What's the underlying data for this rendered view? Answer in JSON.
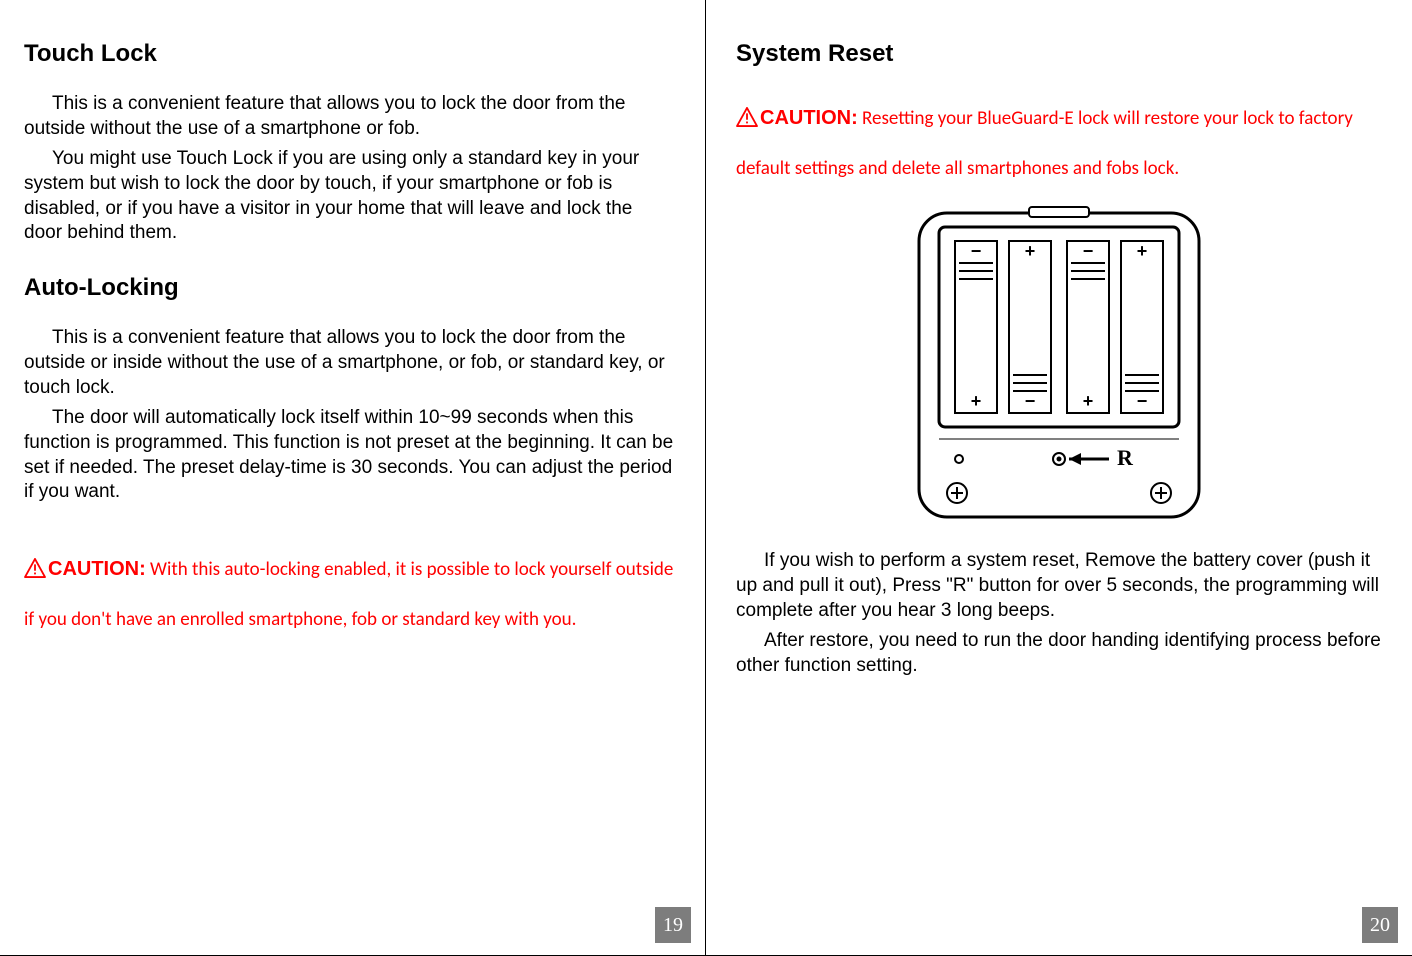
{
  "left": {
    "heading1": "Touch Lock",
    "p1": "This is a convenient feature that allows you to lock the door from the outside without the use of a smartphone or fob.",
    "p2": "You might use Touch Lock if you are using only a standard key in your system but wish to lock the door by touch, if your smartphone or fob is disabled, or if you have a visitor in your home that will leave and lock the door behind them.",
    "heading2": "Auto-Locking",
    "p3": "This is a convenient feature that allows you to lock the door from the outside or inside without the use of a smartphone, or fob, or standard key, or touch lock.",
    "p4": "The door will automatically lock itself within 10~99 seconds when this function is programmed. This function is not preset at the beginning. It can be set if needed. The preset delay-time is 30 seconds. You can adjust the period if you want.",
    "caution_label": "CAUTION:",
    "caution_text": " With this auto-locking enabled, it is possible to lock yourself outside if you don't have an enrolled smartphone, fob or standard key with you.",
    "page_num": "19"
  },
  "right": {
    "heading1": "System Reset",
    "caution_label": "CAUTION:",
    "caution_text": " Resetting your BlueGuard-E lock will restore your lock to factory default settings and delete all smartphones and fobs lock.",
    "figure_label_R": "R",
    "p1": "If you wish to perform a system reset, Remove the battery cover (push it up and pull it out), Press \"R\" button for over 5 seconds, the programming will complete after you hear 3 long beeps.",
    "p2": "After restore, you need to run the door handing identifying process before other function setting.",
    "page_num": "20"
  }
}
